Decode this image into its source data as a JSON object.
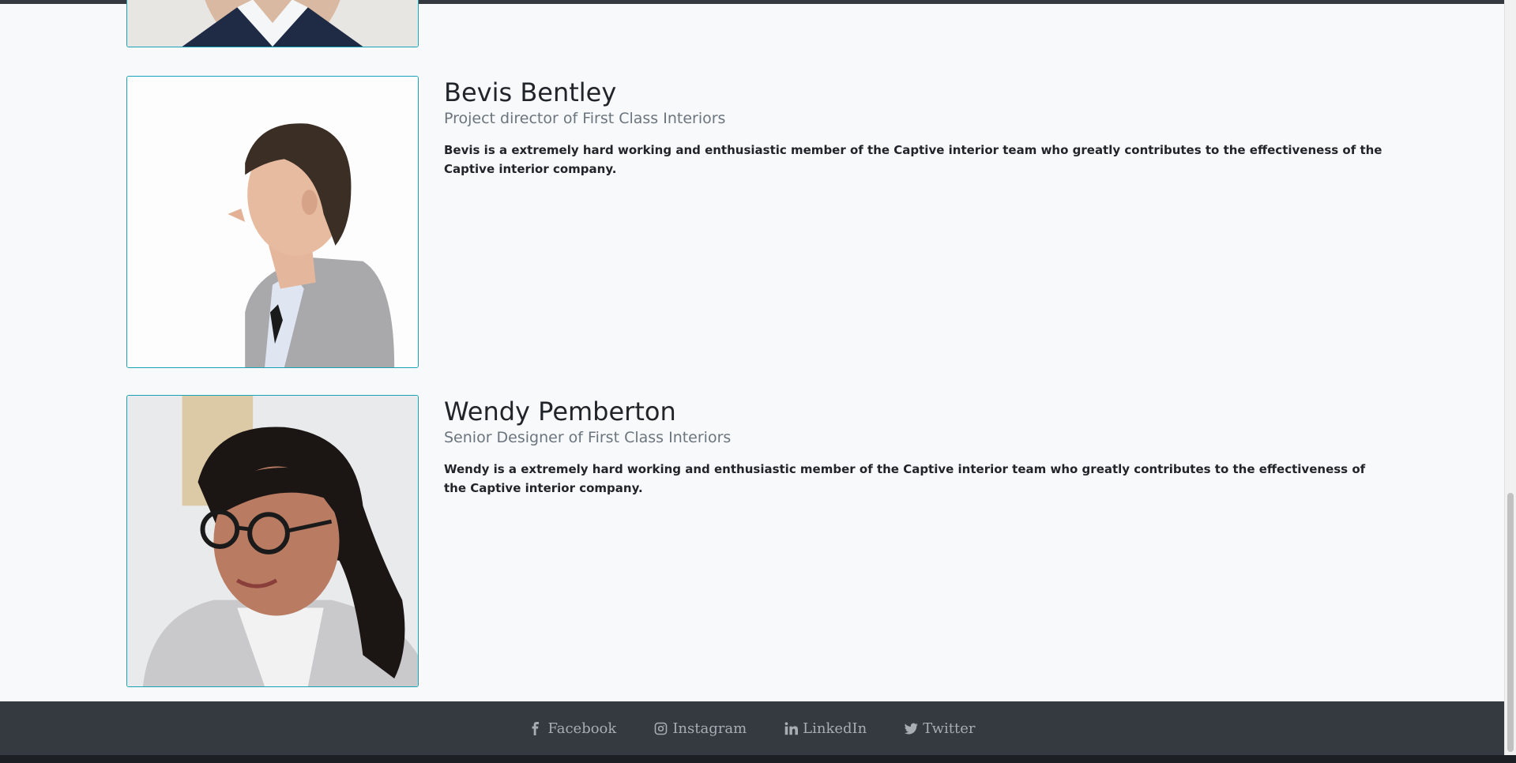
{
  "team": [
    {
      "name": "Bevis Bentley",
      "role": "Project director of First Class Interiors",
      "bio": "Bevis is a extremely hard working and enthusiastic member of the Captive interior team who greatly contributes to the effectiveness of the Captive interior company."
    },
    {
      "name": "Wendy Pemberton",
      "role": "Senior Designer of First Class Interiors",
      "bio": "Wendy is a extremely hard working and enthusiastic member of the Captive interior team who greatly contributes to the effectiveness of the Captive interior company."
    }
  ],
  "footer": {
    "links": [
      {
        "label": "Facebook",
        "icon": "facebook-icon"
      },
      {
        "label": "Instagram",
        "icon": "instagram-icon"
      },
      {
        "label": "LinkedIn",
        "icon": "linkedin-icon"
      },
      {
        "label": "Twitter",
        "icon": "twitter-icon"
      }
    ]
  },
  "colors": {
    "accent_border": "#17a2b8",
    "footer_bg": "#343a40",
    "footer_link": "#a7adb3",
    "muted_text": "#6c757d"
  }
}
